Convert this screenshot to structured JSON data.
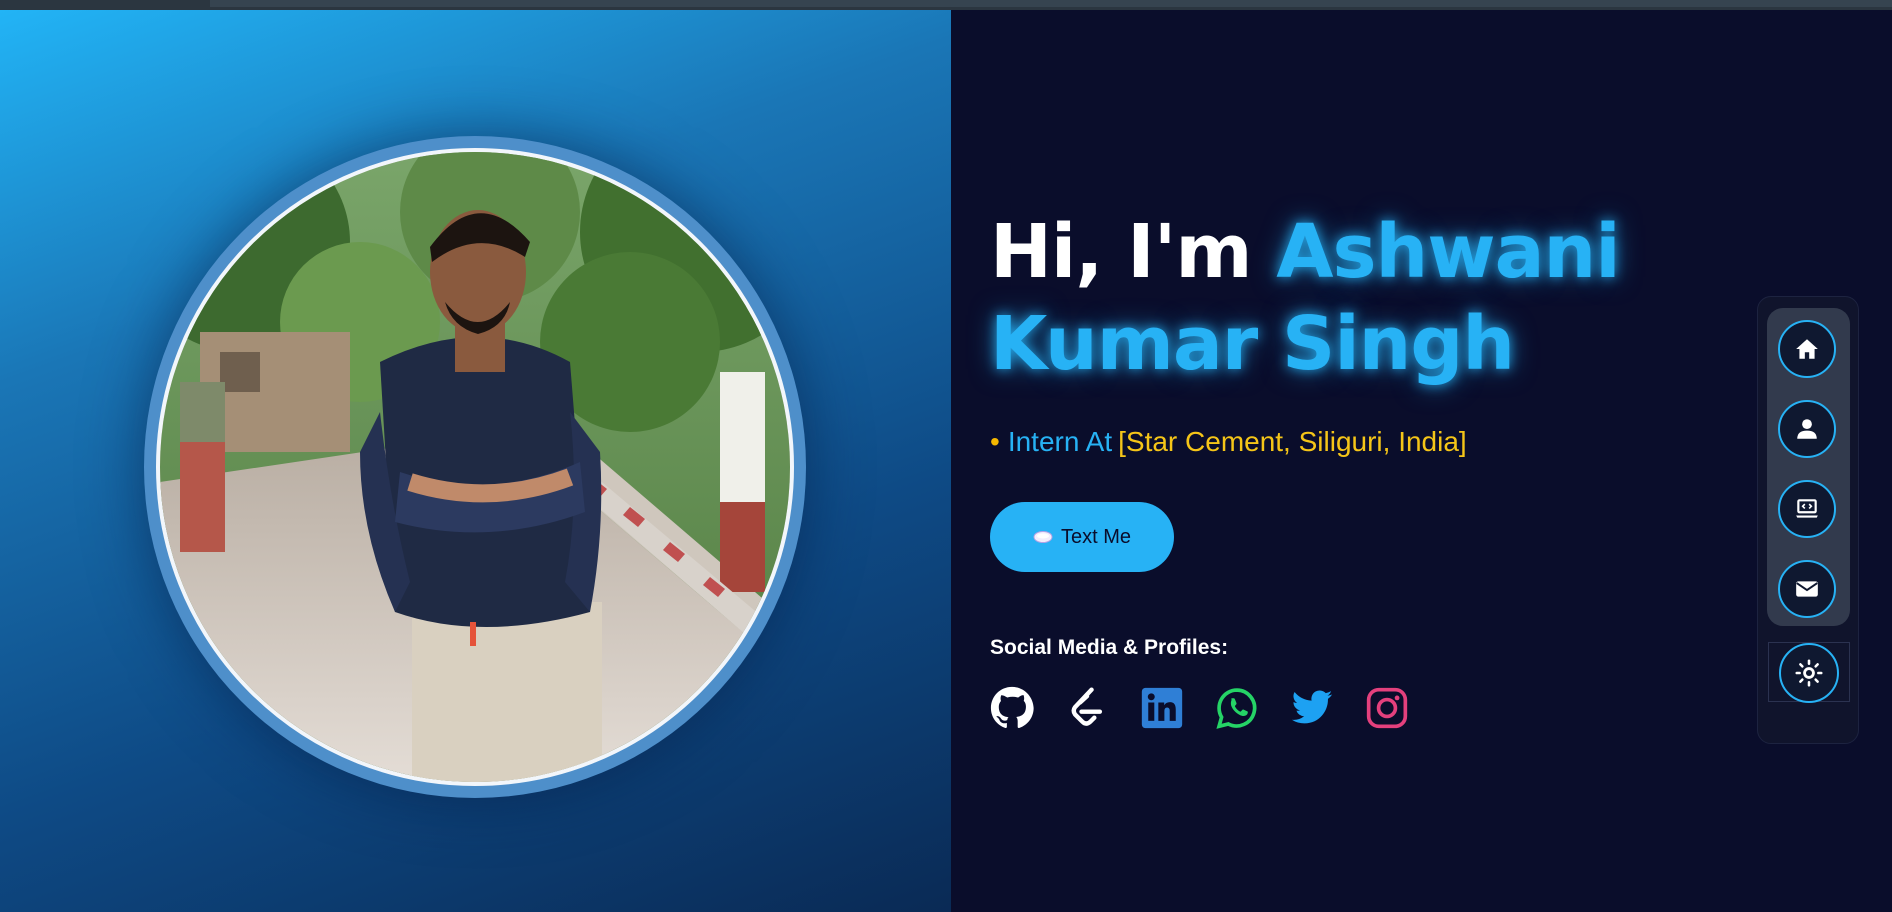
{
  "hero": {
    "greeting": "Hi, I'm ",
    "name": "Ashwani Kumar Singh",
    "role_bullet": "•",
    "role_label": "Intern At",
    "role_company": "[Star Cement, Siliguri, India]"
  },
  "cta": {
    "text_me_label": "Text Me",
    "icon": "speech-bubble-icon"
  },
  "social": {
    "heading": "Social Media & Profiles:",
    "items": [
      {
        "name": "github",
        "icon": "github-icon",
        "color": "#ffffff"
      },
      {
        "name": "leetcode",
        "icon": "leetcode-icon",
        "color": "#ffffff"
      },
      {
        "name": "linkedin",
        "icon": "linkedin-icon",
        "color": "#2f7fd6"
      },
      {
        "name": "whatsapp",
        "icon": "whatsapp-icon",
        "color": "#25d366"
      },
      {
        "name": "twitter",
        "icon": "twitter-icon",
        "color": "#1da1f2"
      },
      {
        "name": "instagram",
        "icon": "instagram-icon",
        "color": "#e4407d"
      }
    ]
  },
  "side_nav": {
    "items": [
      {
        "icon": "home-icon"
      },
      {
        "icon": "user-icon"
      },
      {
        "icon": "laptop-code-icon"
      },
      {
        "icon": "envelope-icon"
      }
    ],
    "theme_toggle": {
      "icon": "sun-icon"
    }
  },
  "profile_photo": {
    "alt": "profile-photo"
  },
  "colors": {
    "accent": "#27b2f5",
    "company": "#f5c518",
    "background": "#0a0d2b"
  }
}
